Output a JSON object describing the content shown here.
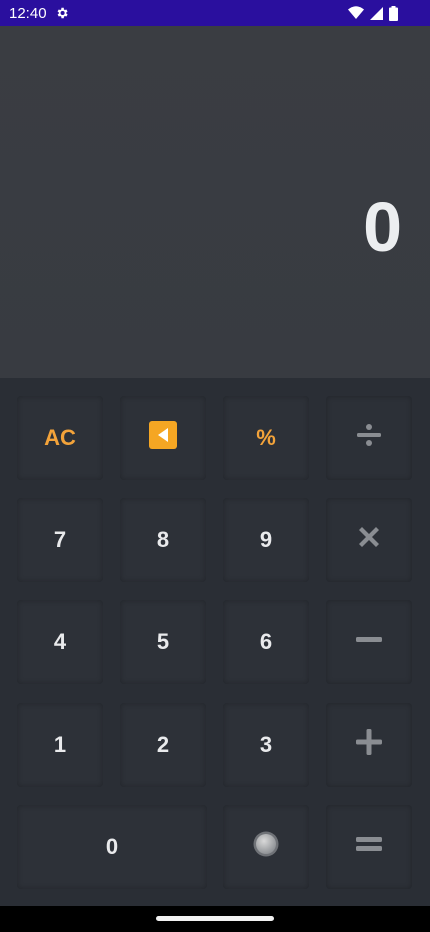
{
  "status_bar": {
    "time": "12:40"
  },
  "display": {
    "value": "0"
  },
  "keys": {
    "ac": "AC",
    "percent": "%",
    "seven": "7",
    "eight": "8",
    "nine": "9",
    "four": "4",
    "five": "5",
    "six": "6",
    "one": "1",
    "two": "2",
    "three": "3",
    "zero": "0"
  },
  "icons": {
    "backspace": "backspace-icon",
    "divide": "divide-icon",
    "multiply": "multiply-icon",
    "minus": "minus-icon",
    "plus": "plus-icon",
    "decimal": "decimal-icon",
    "equals": "equals-icon"
  },
  "colors": {
    "accent": "#f3a33a",
    "status_bar": "#2a0f9e",
    "display_bg": "#3a3d42",
    "keypad_bg": "#2a2e35"
  }
}
